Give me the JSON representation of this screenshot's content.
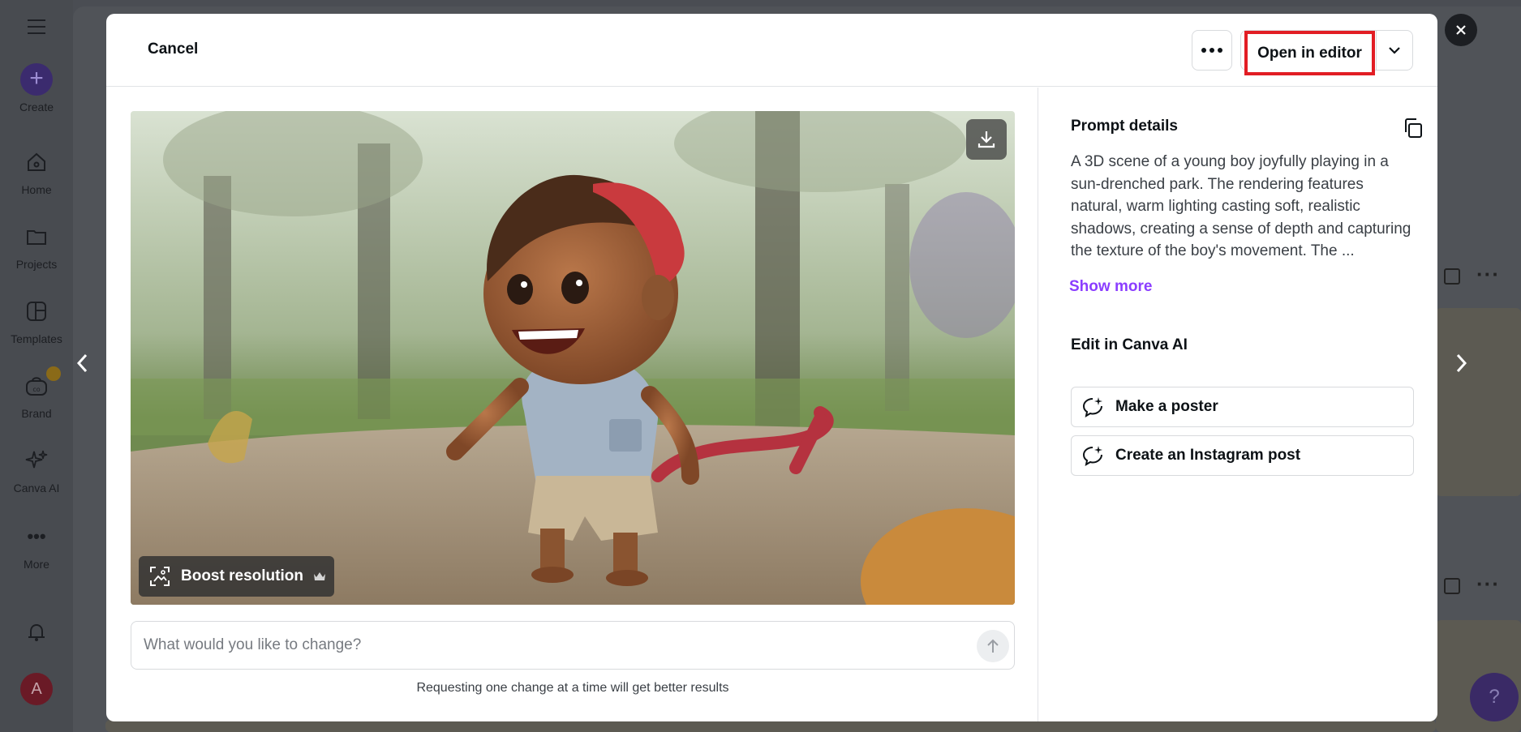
{
  "sidebar": {
    "items": [
      {
        "label": "Create",
        "icon": "plus-icon"
      },
      {
        "label": "Home",
        "icon": "home-icon"
      },
      {
        "label": "Projects",
        "icon": "folder-icon"
      },
      {
        "label": "Templates",
        "icon": "templates-icon"
      },
      {
        "label": "Brand",
        "icon": "brand-icon"
      },
      {
        "label": "Canva AI",
        "icon": "sparkle-icon"
      },
      {
        "label": "More",
        "icon": "more-dots-icon"
      }
    ],
    "avatar_initial": "A"
  },
  "modal": {
    "cancel_label": "Cancel",
    "open_editor_label": "Open in editor",
    "boost_label": "Boost resolution",
    "change_placeholder": "What would you like to change?",
    "hint": "Requesting one change at a time will get better results",
    "prompt_title": "Prompt details",
    "prompt_text": "A 3D scene of a young boy joyfully playing in a sun-drenched park. The rendering features natural, warm lighting casting soft, realistic shadows, creating a sense of depth and capturing the texture of the boy's movement. The ...",
    "show_more": "Show more",
    "edit_title": "Edit in Canva AI",
    "edit_actions": [
      "Make a poster",
      "Create an Instagram post"
    ]
  },
  "help_label": "?",
  "colors": {
    "accent": "#8b3dff",
    "highlight": "#e21d24"
  }
}
